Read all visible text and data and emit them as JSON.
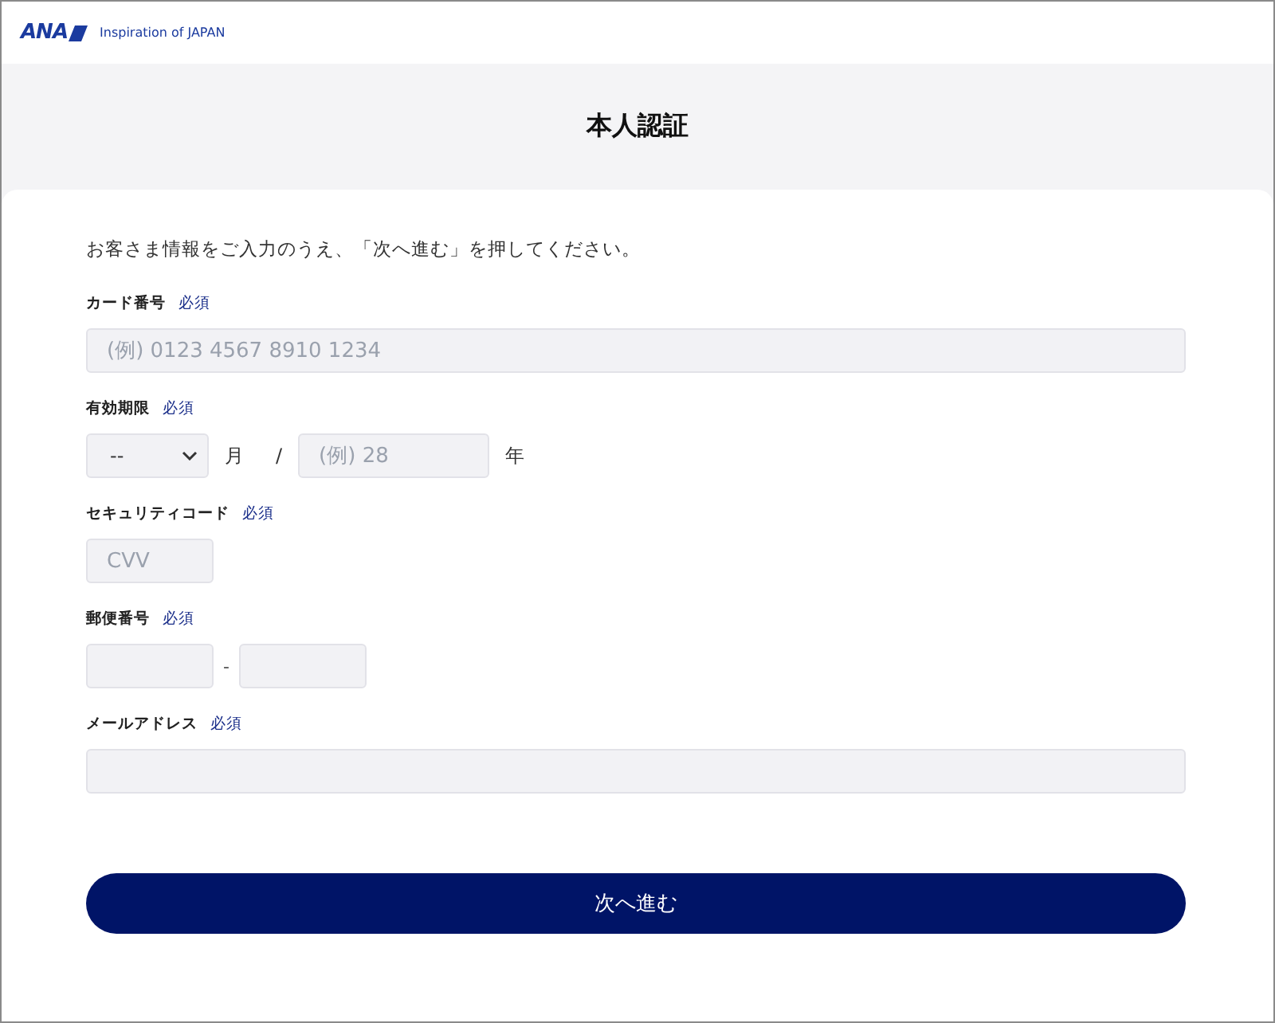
{
  "header": {
    "logo": "ANA",
    "tagline": "Inspiration of JAPAN"
  },
  "title": "本人認証",
  "instruction": "お客さま情報をご入力のうえ、「次へ進む」を押してください。",
  "fields": [
    {
      "kind": "text",
      "label": "カード番号",
      "required": "必須",
      "placeholder": "(例) 0123 4567 8910 1234"
    },
    {
      "kind": "expiry",
      "label": "有効期限",
      "required": "必須",
      "select_value": "--",
      "month_unit": "月",
      "separator": "/",
      "placeholder": "(例) 28",
      "year_unit": "年"
    },
    {
      "kind": "short_text",
      "label": "セキュリティコード",
      "required": "必須",
      "placeholder": "CVV"
    },
    {
      "kind": "postal",
      "label": "郵便番号",
      "required": "必須",
      "separator": "-"
    },
    {
      "kind": "text",
      "label": "メールアドレス",
      "required": "必須"
    }
  ],
  "submit": "次へ進む"
}
